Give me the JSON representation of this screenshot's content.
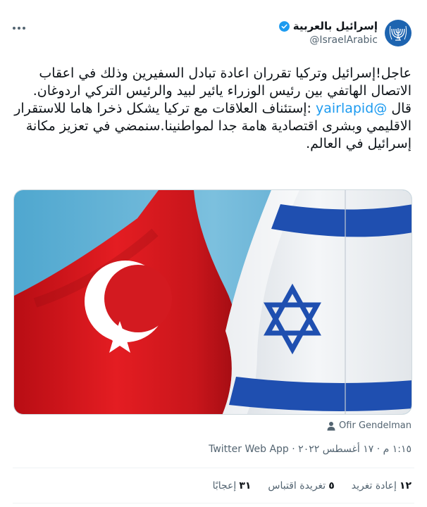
{
  "tweet": {
    "display_name": "إسرائيل بالعربية",
    "handle": "@IsraelArabic",
    "text_before": "عاجل!إسرائيل وتركيا تقرران اعادة تبادل السفيرين وذلك في اعقاب الاتصال الهاتفي بين رئيس الوزراء يائير لبيد والرئيس التركي اردوغان. قال ",
    "mention": "@yairlapid",
    "text_after": " :إستئناف العلاقات مع تركيا يشكل ذخرا هاما للاستقرار الاقليمي وبشرى اقتصادية هامة جدا لمواطنينا.سنمضي في تعزيز مكانة إسرائيل في العالم.",
    "tagged_user": "Ofir Gendelman",
    "time": "١:١٥ م",
    "date": "١٧ أغسطس ٢٠٢٢",
    "separator": "·",
    "source": "Twitter Web App",
    "stats": [
      {
        "num": "١٢",
        "label": "إعادة تغريد"
      },
      {
        "num": "٥",
        "label": "تغريدة اقتباس"
      },
      {
        "num": "٣١",
        "label": "إعجابًا"
      }
    ]
  },
  "icons": {
    "avatar": "israel-emblem-menorah",
    "verified": "verified-badge-icon",
    "more": "more-options-icon",
    "tagged": "person-icon"
  },
  "colors": {
    "accent": "#1d9bf0",
    "avatar_bg": "#1d64b0",
    "secondary_text": "#536471",
    "turkey_red": "#e30a17",
    "israel_blue": "#1f4fb0"
  }
}
